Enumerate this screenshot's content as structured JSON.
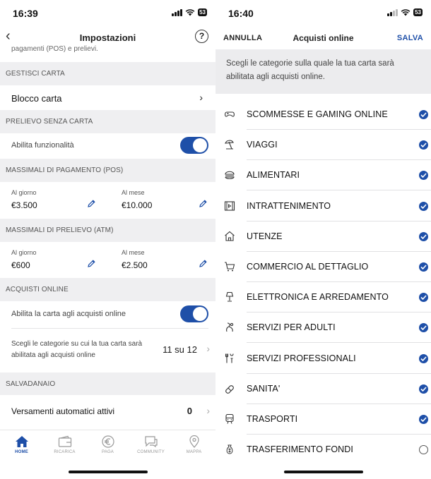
{
  "left": {
    "status_time": "16:39",
    "battery": "53",
    "title": "Impostazioni",
    "help": "?",
    "cut_text": "pagamenti (POS) e prelievi.",
    "sections": {
      "gestisci": "GESTISCI CARTA",
      "prelievo": "PRELIEVO SENZA CARTA",
      "massimali_pos": "MASSIMALI DI PAGAMENTO (POS)",
      "massimali_atm": "MASSIMALI DI PRELIEVO (ATM)",
      "acquisti": "ACQUISTI ONLINE",
      "salvadanaio": "SALVADANAIO"
    },
    "blocco_carta": "Blocco carta",
    "abilita_funzionalita": "Abilita funzionalità",
    "pos": {
      "day_label": "Al giorno",
      "day_value": "€3.500",
      "month_label": "Al mese",
      "month_value": "€10.000"
    },
    "atm": {
      "day_label": "Al giorno",
      "day_value": "€600",
      "month_label": "Al mese",
      "month_value": "€2.500"
    },
    "abilita_online": "Abilita la carta agli acquisti online",
    "categorie_text": "Scegli le categorie su cui la tua carta sarà abilitata agli acquisti online",
    "categorie_count": "11 su 12",
    "versamenti": "Versamenti automatici attivi",
    "versamenti_count": "0",
    "tabs": [
      {
        "label": "HOME",
        "icon": "home-icon"
      },
      {
        "label": "RICARICA",
        "icon": "wallet-icon"
      },
      {
        "label": "PAGA",
        "icon": "euro-icon"
      },
      {
        "label": "COMMUNITY",
        "icon": "chat-icon"
      },
      {
        "label": "MAPPA",
        "icon": "map-pin-icon"
      }
    ]
  },
  "right": {
    "status_time": "16:40",
    "battery": "53",
    "cancel": "ANNULLA",
    "title": "Acquisti online",
    "save": "SALVA",
    "info": "Scegli le categorie sulla quale la tua carta sarà abilitata agli acquisti online.",
    "categories": [
      {
        "label": "SCOMMESSE E GAMING ONLINE",
        "icon": "gamepad-icon",
        "checked": true
      },
      {
        "label": "VIAGGI",
        "icon": "beach-umbrella-icon",
        "checked": true
      },
      {
        "label": "ALIMENTARI",
        "icon": "burger-icon",
        "checked": true
      },
      {
        "label": "INTRATTENIMENTO",
        "icon": "film-icon",
        "checked": true
      },
      {
        "label": "UTENZE",
        "icon": "house-icon",
        "checked": true
      },
      {
        "label": "COMMERCIO AL DETTAGLIO",
        "icon": "cart-icon",
        "checked": true
      },
      {
        "label": "ELETTRONICA E ARREDAMENTO",
        "icon": "lamp-icon",
        "checked": true
      },
      {
        "label": "SERVIZI PER ADULTI",
        "icon": "adult-icon",
        "checked": true
      },
      {
        "label": "SERVIZI PROFESSIONALI",
        "icon": "tools-icon",
        "checked": true
      },
      {
        "label": "SANITA'",
        "icon": "pill-icon",
        "checked": true
      },
      {
        "label": "TRASPORTI",
        "icon": "train-icon",
        "checked": true
      },
      {
        "label": "TRASFERIMENTO FONDI",
        "icon": "money-bag-icon",
        "checked": false
      }
    ]
  },
  "colors": {
    "accent": "#1e4fa8",
    "section_bg": "#efeff1"
  }
}
